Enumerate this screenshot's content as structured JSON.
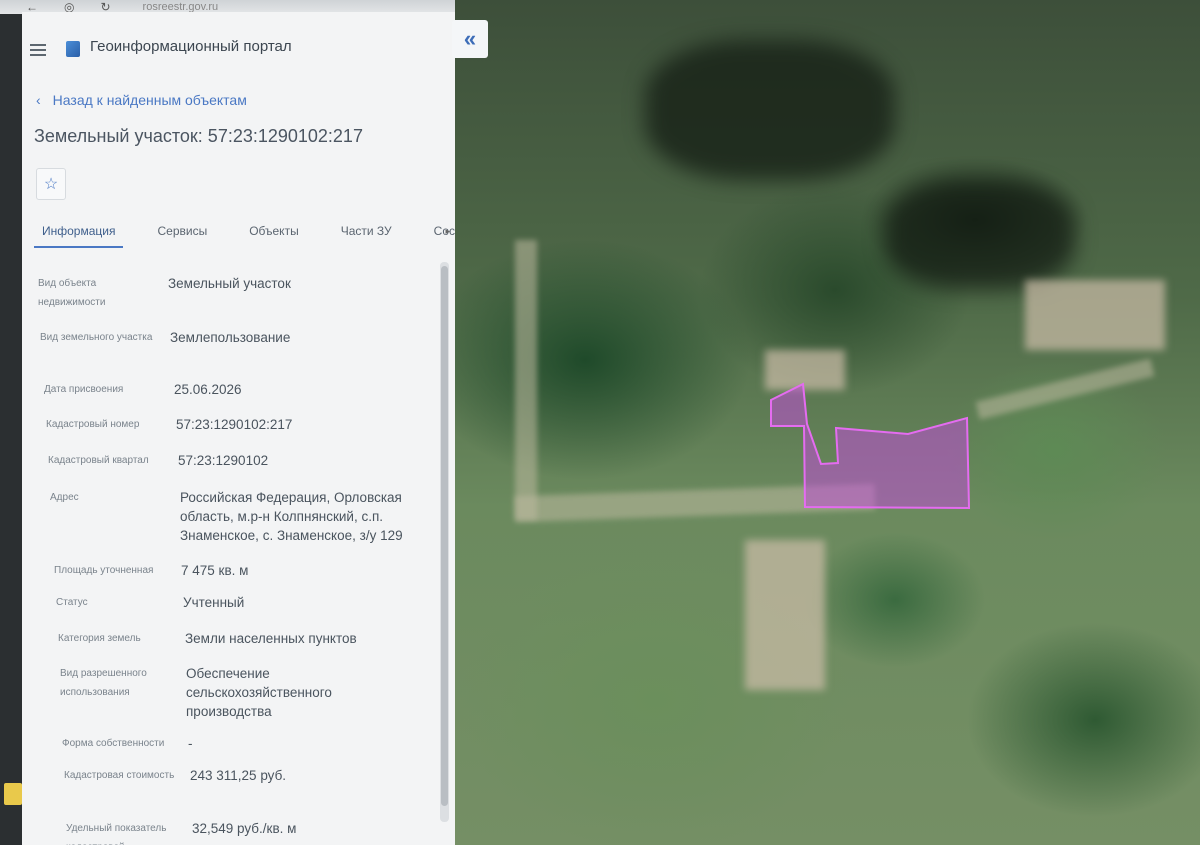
{
  "browser": {
    "url": "rosreestr.gov.ru"
  },
  "header": {
    "title": "Геоинформационный портал"
  },
  "nav": {
    "back_label": "Назад к найденным объектам"
  },
  "object": {
    "title": "Земельный участок: 57:23:1290102:217"
  },
  "tabs": [
    {
      "label": "Информация",
      "active": true
    },
    {
      "label": "Сервисы"
    },
    {
      "label": "Объекты"
    },
    {
      "label": "Части ЗУ"
    },
    {
      "label": "Состав"
    }
  ],
  "info": [
    {
      "label": "Вид объекта недвижимости",
      "value": "Земельный участок"
    },
    {
      "label": "Вид земельного участка",
      "value": "Землепользование"
    },
    {
      "label": "Дата присвоения",
      "value": "25.06.2026"
    },
    {
      "label": "Кадастровый номер",
      "value": "57:23:1290102:217"
    },
    {
      "label": "Кадастровый квартал",
      "value": "57:23:1290102"
    },
    {
      "label": "Адрес",
      "value": "Российская Федерация, Орловская область, м.р-н Колпнянский, с.п. Знаменское, с. Знаменское, з/у 129"
    },
    {
      "label": "Площадь уточненная",
      "value": "7 475 кв. м"
    },
    {
      "label": "Статус",
      "value": "Учтенный"
    },
    {
      "label": "Категория земель",
      "value": "Земли населенных пунктов"
    },
    {
      "label": "Вид разрешенного использования",
      "value": "Обеспечение сельскохозяйственного производства"
    },
    {
      "label": "Форма собственности",
      "value": "-"
    },
    {
      "label": "Кадастровая стоимость",
      "value": "243 311,25 руб."
    },
    {
      "label": "Удельный показатель кадастровой",
      "value": "32,549 руб./кв. м"
    }
  ],
  "map": {
    "parcel_color": "#c04ed6",
    "collapse_icon": "double-chevron-left-icon"
  }
}
